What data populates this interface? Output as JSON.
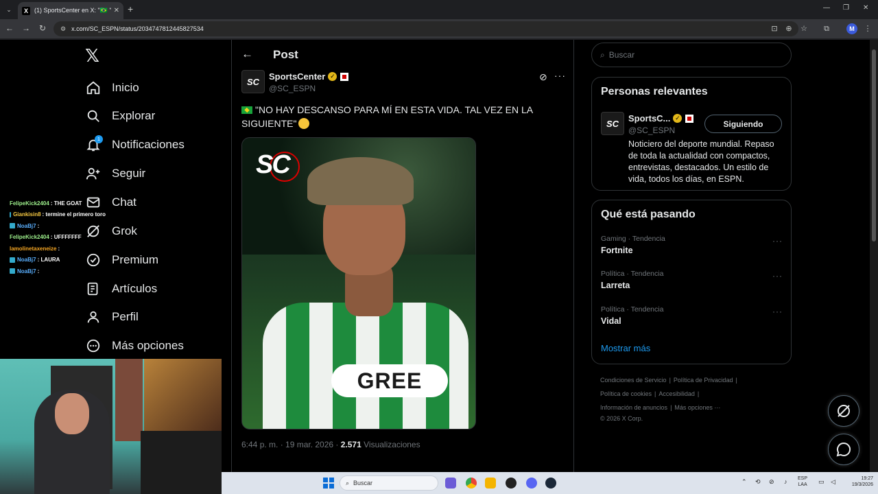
{
  "browser": {
    "tab_title": "(1) SportsCenter en X: \"🇧🇷 \"NO H",
    "url": "x.com/SC_ESPN/status/2034747812445827534",
    "profile_initial": "M"
  },
  "nav": {
    "items": [
      {
        "label": "Inicio",
        "icon": "home-icon"
      },
      {
        "label": "Explorar",
        "icon": "search-icon"
      },
      {
        "label": "Notificaciones",
        "icon": "bell-icon",
        "badge": "1"
      },
      {
        "label": "Seguir",
        "icon": "person-plus-icon"
      },
      {
        "label": "Chat",
        "icon": "mail-icon"
      },
      {
        "label": "Grok",
        "icon": "grok-icon"
      },
      {
        "label": "Premium",
        "icon": "verified-icon"
      },
      {
        "label": "Artículos",
        "icon": "article-icon"
      },
      {
        "label": "Perfil",
        "icon": "person-icon"
      },
      {
        "label": "Más opciones",
        "icon": "more-circle-icon"
      }
    ]
  },
  "stream_chat": [
    {
      "user": "FelipeKick2404",
      "msg": ": THE GOAT",
      "color": "#9ef08c",
      "badge": false
    },
    {
      "user": "Giankisin8",
      "msg": ": termine el primero toro",
      "color": "#f5c842",
      "badge": true
    },
    {
      "user": "NoaBj7",
      "msg": ":",
      "color": "#5ab0ff",
      "badge": true
    },
    {
      "user": "FelipeKick2404",
      "msg": ": UFFFFFFF",
      "color": "#9ef08c",
      "badge": false
    },
    {
      "user": "lamolinetaxeneize",
      "msg": ":",
      "color": "#f5a623",
      "badge": false
    },
    {
      "user": "NoaBj7",
      "msg": ": LAURA",
      "color": "#5ab0ff",
      "badge": true
    },
    {
      "user": "NoaBj7",
      "msg": ":",
      "color": "#5ab0ff",
      "badge": true
    }
  ],
  "post": {
    "header_title": "Post",
    "author_name": "SportsCenter",
    "author_handle": "@SC_ESPN",
    "avatar_text": "SC",
    "text": "\"NO HAY DESCANSO PARA MÍ EN ESTA VIDA. TAL VEZ EN LA SIGUIENTE\"",
    "media_logo": "SC",
    "media_sponsor": "GREE",
    "time": "6:44 p. m. · 19 mar. 2026 · ",
    "views_count": "2.571",
    "views_label": " Visualizaciones"
  },
  "right": {
    "search_placeholder": "Buscar",
    "relevant_title": "Personas relevantes",
    "relevant": {
      "name": "SportsC...",
      "handle": "@SC_ESPN",
      "avatar_text": "SC",
      "button": "Siguiendo",
      "bio": "Noticiero del deporte mundial. Repaso de toda la actualidad con compactos, entrevistas, destacados. Un estilo de vida, todos los días, en ESPN."
    },
    "trends_title": "Qué está pasando",
    "trends": [
      {
        "category": "Gaming · Tendencia",
        "name": "Fortnite"
      },
      {
        "category": "Política · Tendencia",
        "name": "Larreta"
      },
      {
        "category": "Política · Tendencia",
        "name": "Vidal"
      }
    ],
    "show_more": "Mostrar más",
    "footer": {
      "line1": [
        "Condiciones de Servicio",
        "|",
        "Política de Privacidad",
        "|"
      ],
      "line2": [
        "Política de cookies",
        "|",
        "Accesibilidad",
        "|"
      ],
      "line3": [
        "Información de anuncios",
        "|",
        "Más opciones ···"
      ],
      "copyright": "© 2026 X Corp."
    }
  },
  "taskbar": {
    "search": "Buscar",
    "lang1": "ESP",
    "lang2": "LAA",
    "time": "19:27",
    "date": "19/3/2026"
  }
}
